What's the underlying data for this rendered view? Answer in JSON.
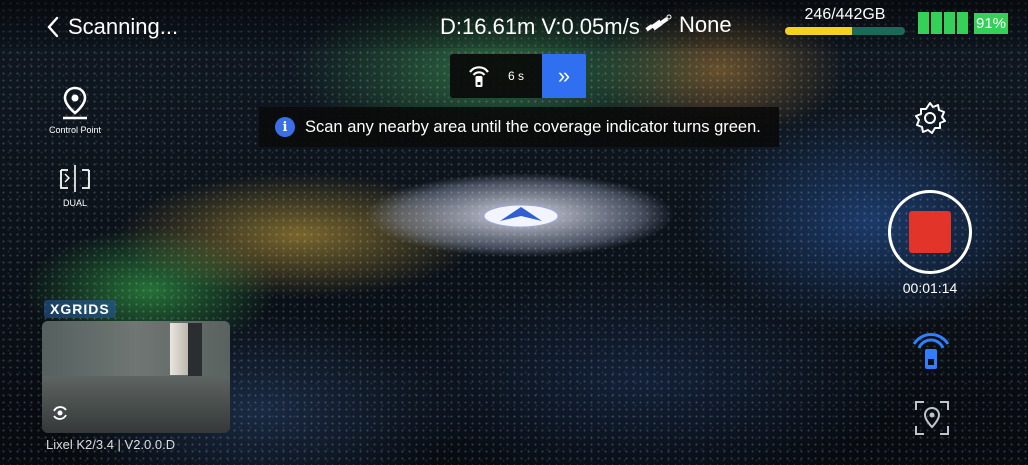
{
  "header": {
    "back_label": "Scanning...",
    "distance_velocity": "D:16.61m V:0.05m/s",
    "gps_status": "None",
    "storage_text": "246/442GB",
    "storage_fraction": 0.557,
    "battery_percent": "91%",
    "battery_fraction": 0.91
  },
  "scan_pill": {
    "countdown": "6 s",
    "next_glyph": "»"
  },
  "toast": {
    "message": "Scan any nearby area until the coverage indicator turns green."
  },
  "left_tools": {
    "control_point_label": "Control Point",
    "dual_label": "DUAL"
  },
  "right_controls": {
    "timer": "00:01:14"
  },
  "camera_preview": {
    "brand": "XGRIDS",
    "device_label": "Lixel K2/3.4 | V2.0.0.D"
  },
  "colors": {
    "accent_blue": "#2f6ff0",
    "record_red": "#e3342a",
    "battery_green": "#34d058",
    "storage_yellow": "#f5d21e"
  }
}
